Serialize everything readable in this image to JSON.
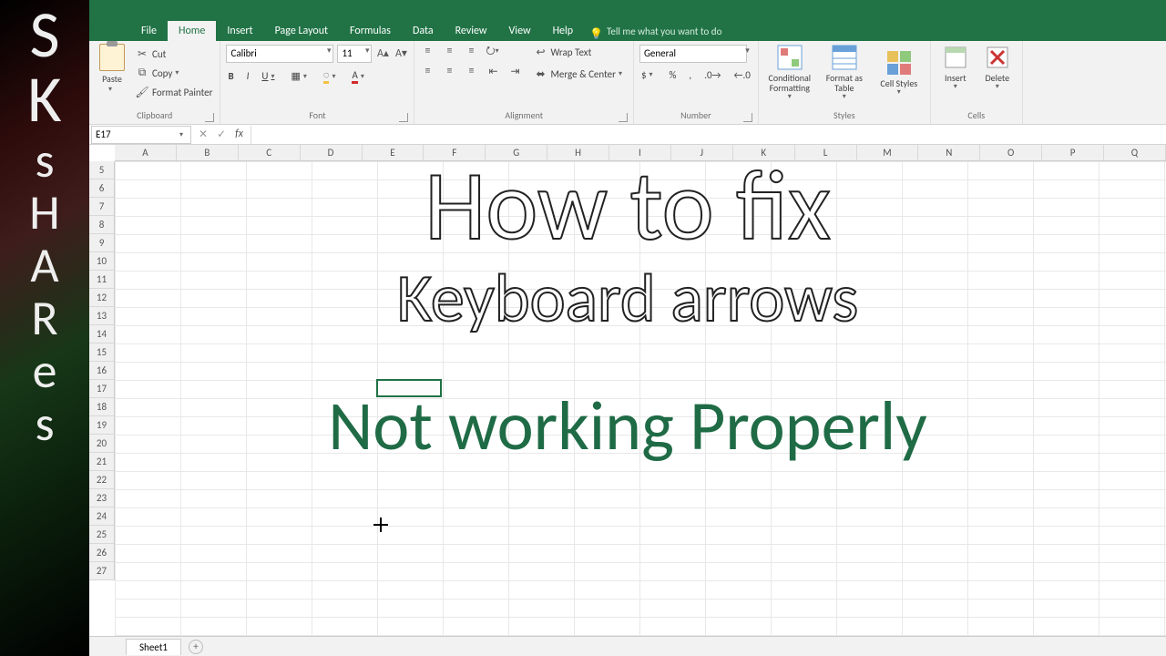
{
  "logo": {
    "big1": "S",
    "big2": "K",
    "rest": [
      "s",
      "H",
      "A",
      "R",
      "e",
      "s"
    ]
  },
  "menu": {
    "file": "File",
    "home": "Home",
    "insert": "Insert",
    "pagelayout": "Page Layout",
    "formulas": "Formulas",
    "data": "Data",
    "review": "Review",
    "view": "View",
    "help": "Help",
    "tell": "Tell me what you want to do"
  },
  "ribbon": {
    "clipboard": {
      "label": "Clipboard",
      "paste": "Paste",
      "cut": "Cut",
      "copy": "Copy",
      "painter": "Format Painter"
    },
    "font": {
      "label": "Font",
      "family": "Calibri",
      "size": "11"
    },
    "alignment": {
      "label": "Alignment",
      "wrap": "Wrap Text",
      "merge": "Merge & Center"
    },
    "number": {
      "label": "Number",
      "format": "General"
    },
    "styles": {
      "label": "Styles",
      "cond": "Conditional Formatting",
      "table": "Format as Table",
      "cell": "Cell Styles"
    },
    "cells": {
      "label": "Cells",
      "insert": "Insert",
      "delete": "Delete"
    }
  },
  "namebox": "E17",
  "columns": [
    "A",
    "B",
    "C",
    "D",
    "E",
    "F",
    "G",
    "H",
    "I",
    "J",
    "K",
    "L",
    "M",
    "N",
    "O",
    "P",
    "Q"
  ],
  "rows": [
    "5",
    "6",
    "7",
    "8",
    "9",
    "10",
    "11",
    "12",
    "13",
    "14",
    "15",
    "16",
    "17",
    "18",
    "19",
    "20",
    "21",
    "22",
    "23",
    "24",
    "25",
    "26",
    "27"
  ],
  "selection": {
    "col": "E",
    "row": "17"
  },
  "sheet_tab": "Sheet1",
  "overlay": {
    "l1": "How to fix",
    "l2": "Keyboard arrows",
    "l3": "Not working Properly"
  }
}
